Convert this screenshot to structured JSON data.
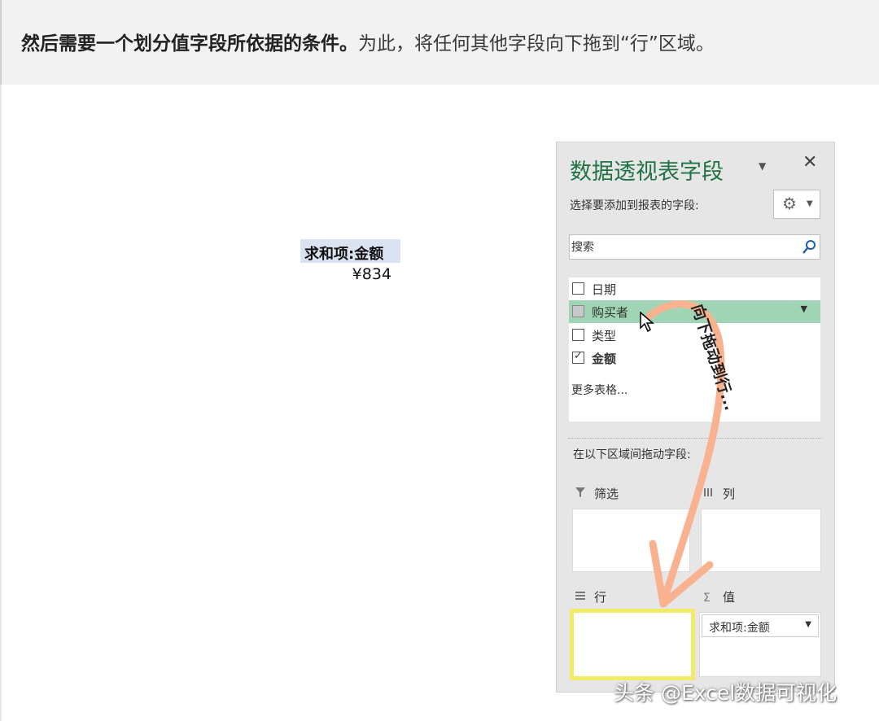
{
  "banner": {
    "bold_text": "然后需要一个划分值字段所依据的条件。",
    "text": "为此，将任何其他字段向下拖到“行”区域。"
  },
  "pivot": {
    "header": "求和项:金额",
    "value": "¥834"
  },
  "panel": {
    "title": "数据透视表字段",
    "dropdown_glyph": "▼",
    "close_glyph": "✕",
    "subtitle": "选择要添加到报表的字段:",
    "gear_glyph": "⚙",
    "search_placeholder": "搜索",
    "fields": [
      {
        "label": "日期",
        "checked": false
      },
      {
        "label": "购买者",
        "checked": false
      },
      {
        "label": "类型",
        "checked": false
      },
      {
        "label": "金额",
        "checked": true
      }
    ],
    "more_tables": "更多表格...",
    "drag_hint": "在以下区域间拖动字段:",
    "zones": {
      "filter": {
        "label": "筛选",
        "icon": "filter-icon"
      },
      "columns": {
        "label": "列",
        "icon": "columns-icon"
      },
      "rows": {
        "label": "行",
        "icon": "rows-icon"
      },
      "values": {
        "label": "值",
        "icon": "sigma-icon",
        "sigma": "Σ",
        "chip": "求和项:金额"
      }
    }
  },
  "annotation": {
    "text": "向下拖动到行...",
    "arrow_color": "#f9b28f",
    "highlight_color": "#f3ea6a"
  },
  "watermark": "头条 @Excel数据可视化"
}
